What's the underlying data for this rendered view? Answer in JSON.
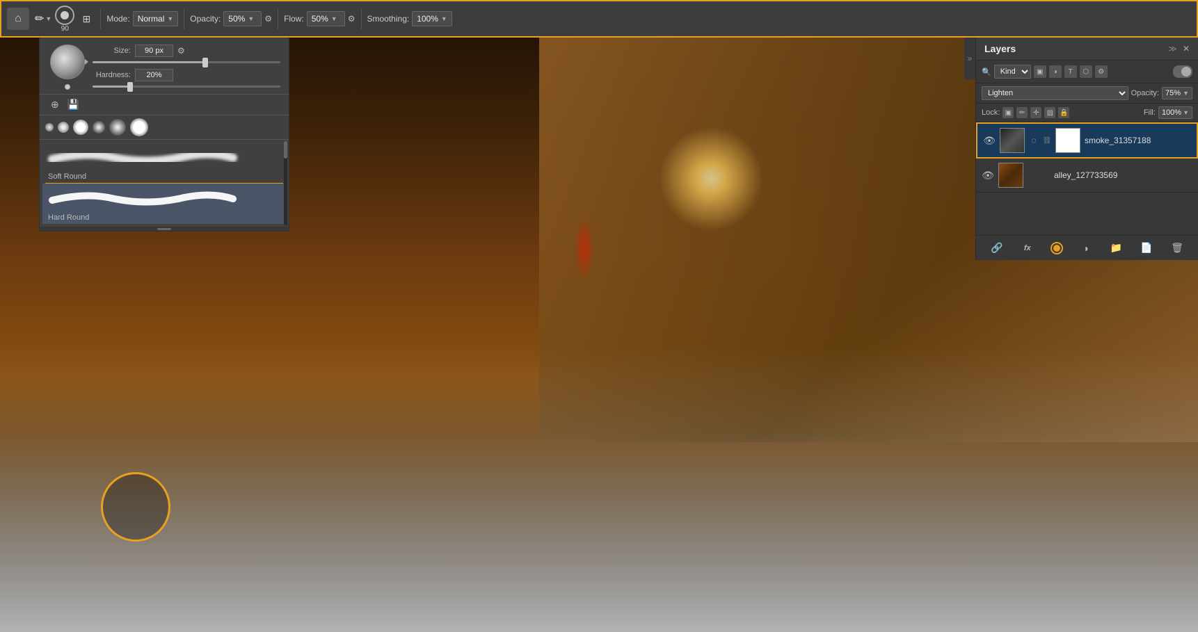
{
  "toolbar": {
    "home_label": "⌂",
    "brush_size": "90",
    "brush_unit": "px",
    "mode_label": "Mode:",
    "mode_value": "Normal",
    "opacity_label": "Opacity:",
    "opacity_value": "50%",
    "flow_label": "Flow:",
    "flow_value": "50%",
    "smoothing_label": "Smoothing:",
    "smoothing_value": "100%"
  },
  "brush_panel": {
    "size_label": "Size:",
    "size_value": "90 px",
    "hardness_label": "Hardness:",
    "hardness_value": "20%",
    "size_slider_pct": 60,
    "hardness_slider_pct": 20,
    "presets": [
      {
        "size": 6,
        "type": "soft"
      },
      {
        "size": 10,
        "type": "soft"
      },
      {
        "size": 16,
        "type": "hard"
      },
      {
        "size": 14,
        "type": "soft"
      },
      {
        "size": 20,
        "type": "soft"
      },
      {
        "size": 20,
        "type": "hard"
      }
    ],
    "brush_items": [
      {
        "name": "Soft Round",
        "selected": false
      },
      {
        "name": "Hard Round",
        "selected": true
      }
    ]
  },
  "layers_panel": {
    "title": "Layers",
    "kind_label": "Kind",
    "blend_mode": "Lighten",
    "opacity_label": "Opacity:",
    "opacity_value": "75%",
    "fill_label": "Fill:",
    "fill_value": "100%",
    "lock_label": "Lock:",
    "layers": [
      {
        "name": "smoke_31357188",
        "visible": true,
        "selected": true,
        "has_mask": true
      },
      {
        "name": "alley_127733569",
        "visible": true,
        "selected": false,
        "has_mask": false
      }
    ],
    "bottom_icons": [
      "link",
      "fx",
      "circle-filled",
      "circle",
      "folder",
      "new-layer",
      "trash"
    ]
  },
  "canvas": {
    "brush_cursor_visible": true
  }
}
